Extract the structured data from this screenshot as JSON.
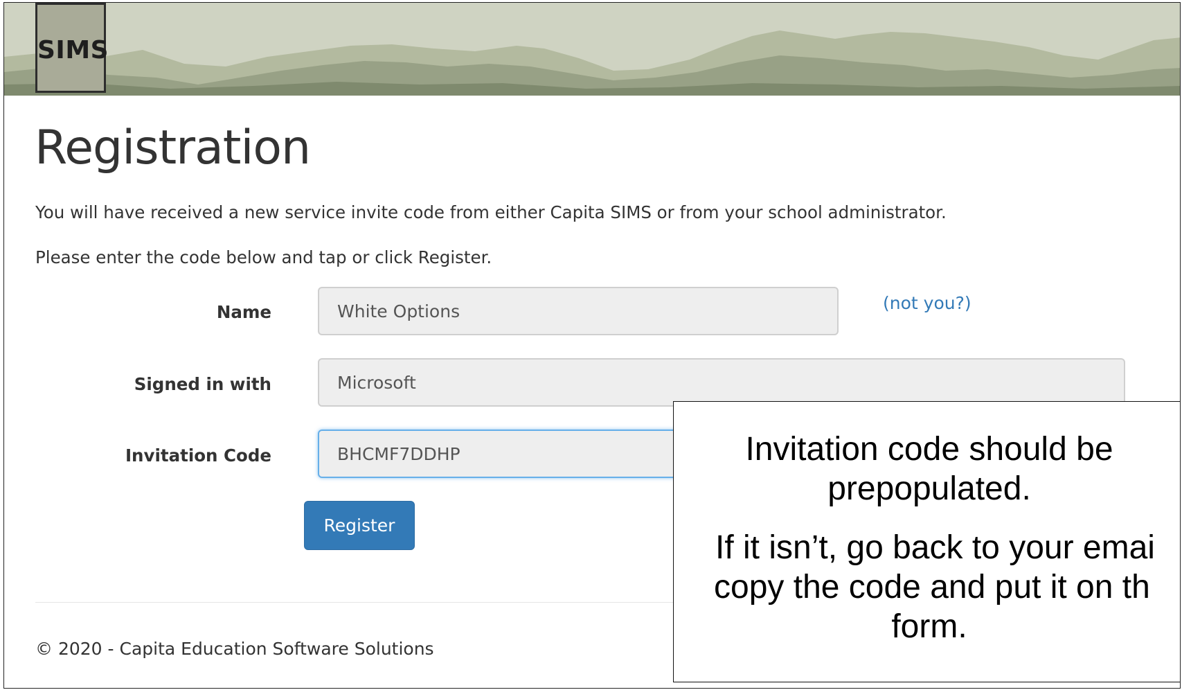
{
  "header": {
    "logo_text": "SIMS"
  },
  "page": {
    "title": "Registration",
    "intro_line_1": "You will have received a new service invite code from either Capita SIMS or from your school administrator.",
    "intro_line_2": "Please enter the code below and tap or click Register."
  },
  "form": {
    "name_label": "Name",
    "name_value": "White Options",
    "not_you_link": "(not you?)",
    "signed_in_label": "Signed in with",
    "signed_in_value": "Microsoft",
    "invitation_code_label": "Invitation Code",
    "invitation_code_value": "BHCMF7DDHP",
    "register_button": "Register"
  },
  "footer": {
    "copyright": "© 2020 - Capita Education Software Solutions"
  },
  "callout": {
    "line_1": "Invitation code should be",
    "line_2": "prepopulated.",
    "line_3": "If it isn’t, go back to your emai",
    "line_4": "copy the code and put it on th",
    "line_5": "form."
  },
  "colors": {
    "primary_button": "#337ab7",
    "link": "#337ab7",
    "banner_background": "#cfd3c2",
    "focus_border": "#66afe9"
  }
}
